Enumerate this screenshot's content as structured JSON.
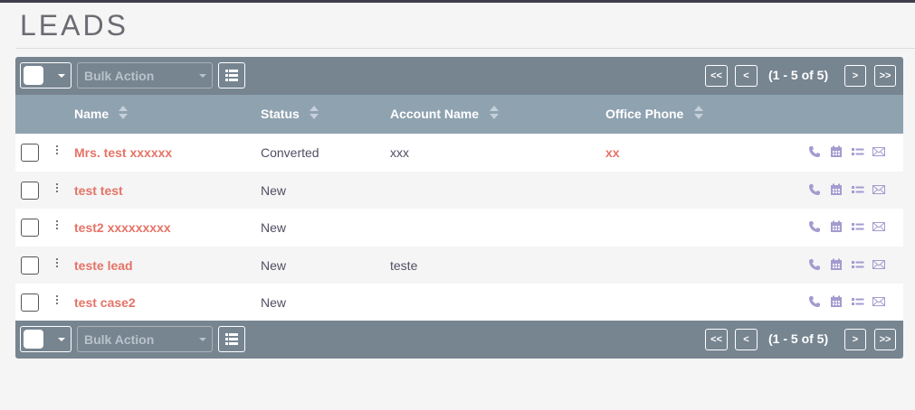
{
  "page": {
    "title": "LEADS"
  },
  "toolbar": {
    "bulk_action_label": "Bulk Action",
    "pagination": {
      "first_label": "<<",
      "prev_label": "<",
      "next_label": ">",
      "last_label": ">>",
      "info": "(1 - 5 of 5)"
    }
  },
  "table": {
    "columns": [
      {
        "label": "Name"
      },
      {
        "label": "Status"
      },
      {
        "label": "Account Name"
      },
      {
        "label": "Office Phone"
      }
    ],
    "rows": [
      {
        "name": "Mrs. test xxxxxx",
        "status": "Converted",
        "account": "xxx",
        "phone": "xx"
      },
      {
        "name": "test test",
        "status": "New",
        "account": "",
        "phone": ""
      },
      {
        "name": "test2 xxxxxxxxx",
        "status": "New",
        "account": "",
        "phone": ""
      },
      {
        "name": "teste lead",
        "status": "New",
        "account": "teste",
        "phone": ""
      },
      {
        "name": "test case2",
        "status": "New",
        "account": "",
        "phone": ""
      }
    ],
    "row_action_icons": [
      "phone-icon",
      "calendar-icon",
      "task-list-icon",
      "email-icon"
    ]
  },
  "colors": {
    "accent_link": "#e57367",
    "toolbar_bg": "#778591",
    "header_bg": "#8fa2b0",
    "action_icon": "#a59bd0"
  }
}
